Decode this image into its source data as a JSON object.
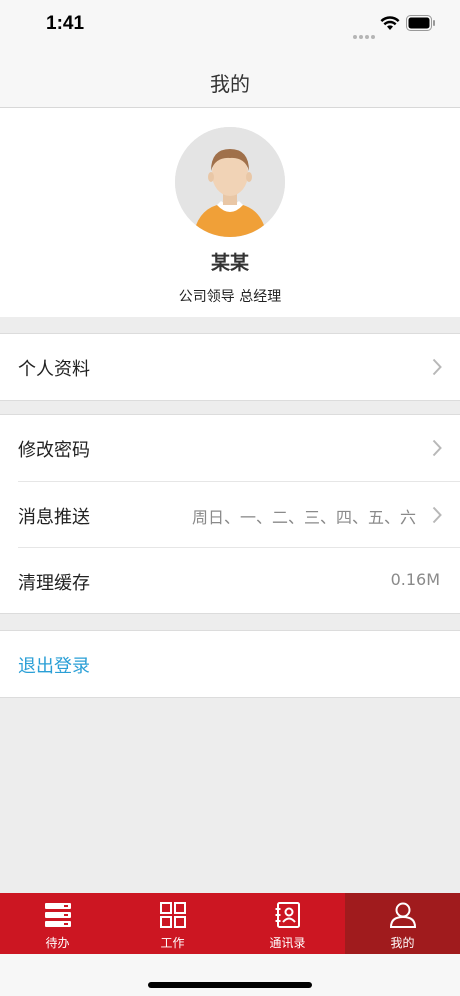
{
  "status_bar": {
    "time": "1:41"
  },
  "nav": {
    "title": "我的"
  },
  "profile": {
    "name": "某某",
    "role": "公司领导 总经理"
  },
  "menu": {
    "profile_label": "个人资料",
    "change_password_label": "修改密码",
    "push_label": "消息推送",
    "push_value": "周日、一、二、三、四、五、六",
    "cache_label": "清理缓存",
    "cache_value": "0.16M",
    "logout_label": "退出登录"
  },
  "tabs": [
    {
      "label": "待办",
      "icon": "todo-icon"
    },
    {
      "label": "工作",
      "icon": "grid-icon"
    },
    {
      "label": "通讯录",
      "icon": "contacts-icon"
    },
    {
      "label": "我的",
      "icon": "person-icon",
      "active": true
    }
  ],
  "colors": {
    "tab_bar": "#cc1622",
    "tab_active": "#a01b1d",
    "logout": "#2a9fd6"
  }
}
